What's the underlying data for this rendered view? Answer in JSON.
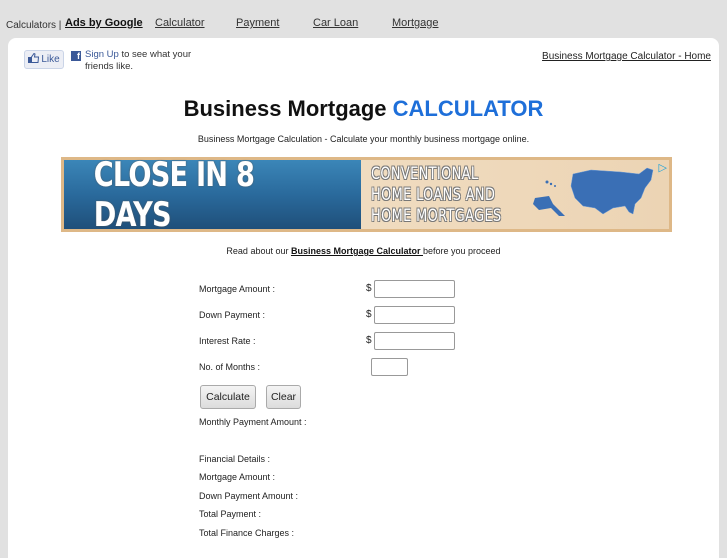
{
  "topbar": {
    "calculators_label": "Calculators |",
    "ads_by_google": "Ads by Google",
    "nav_links": [
      "Calculator",
      "Payment",
      "Car Loan",
      "Mortgage"
    ]
  },
  "social": {
    "like_label": "Like",
    "signup_link": "Sign Up",
    "signup_text": " to see what your friends like."
  },
  "header": {
    "home_link": "Business Mortgage Calculator - Home",
    "title_main": "Business Mortgage ",
    "title_accent": "CALCULATOR",
    "subtitle": "Business Mortgage Calculation - Calculate your monthly business mortgage online.",
    "accent_color": "#1e6fd9"
  },
  "ad": {
    "headline": "CLOSE IN 8 DAYS",
    "copy_lines": [
      "CONVENTIONAL",
      "HOME LOANS AND",
      "HOME MORTGAGES"
    ],
    "adchoices_icon": "adchoices-icon"
  },
  "read_about": {
    "prefix": "Read about our ",
    "link": "Business Mortgage Calculator ",
    "suffix": "before you proceed"
  },
  "form": {
    "fields": [
      {
        "label": "Mortgage Amount :",
        "currency": "$",
        "value": ""
      },
      {
        "label": "Down Payment :",
        "currency": "$",
        "value": ""
      },
      {
        "label": "Interest Rate :",
        "currency": "$",
        "value": ""
      },
      {
        "label": "No. of Months :",
        "value": ""
      }
    ],
    "calculate_label": "Calculate",
    "clear_label": "Clear"
  },
  "results": {
    "monthly_payment": "Monthly Payment Amount :",
    "financial_details": "Financial Details :",
    "mortgage_amount": "Mortgage Amount :",
    "down_payment_amount": "Down Payment Amount :",
    "total_payment": "Total Payment :",
    "total_finance_charges": "Total Finance Charges :"
  }
}
